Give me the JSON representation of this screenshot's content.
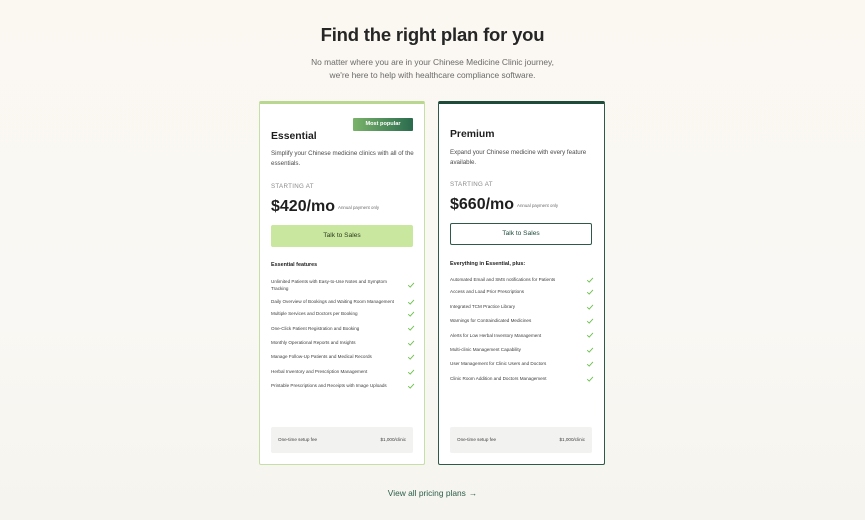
{
  "header": {
    "title": "Find the right plan for you",
    "subtitle_line1": "No matter where you are in your Chinese Medicine Clinic journey,",
    "subtitle_line2": "we're here to help with healthcare compliance software."
  },
  "colors": {
    "accent_light_green": "#c9e79f",
    "accent_dark_green": "#1f4b3a",
    "check_green": "#6cc04a"
  },
  "plans": [
    {
      "badge": "Most popular",
      "name": "Essential",
      "description": "Simplify your Chinese medicine clinics with all of the essentials.",
      "starting_label": "STARTING AT",
      "price": "$420/mo",
      "price_note": "Annual payment only",
      "cta": "Talk to Sales",
      "features_title": "Essential features",
      "features": [
        "Unlimited Patients with Easy-to-Use Notes and Symptom Tracking",
        "Daily Overview of Bookings and Waiting Room Management",
        "Multiple Services and Doctors per Booking",
        "One-Click Patient Registration and Booking",
        "Monthly Operational Reports and Insights",
        "Manage Follow-Up Patients and Medical Records",
        "Herbal Inventory and Prescription Management",
        "Printable Prescriptions and Receipts with Image Uploads"
      ],
      "setup_label": "One-time setup fee",
      "setup_value": "$1,000/clinic"
    },
    {
      "name": "Premium",
      "description": "Expand your Chinese medicine with every feature available.",
      "starting_label": "STARTING AT",
      "price": "$660/mo",
      "price_note": "Annual payment only",
      "cta": "Talk to Sales",
      "features_title": "Everything in Essential, plus:",
      "features": [
        "Automated Email and SMS notifications for Patients",
        "Access and Load Prior Prescriptions",
        "Integrated TCM Practice Library",
        "Warnings for Contraindicated Medicines",
        "Alerts for Low Herbal Inventory Management",
        "Multi-clinic Management Capability",
        "User Management for Clinic Users and Doctors",
        "Clinic Room Addition and Doctors Management"
      ],
      "setup_label": "One-time setup fee",
      "setup_value": "$1,000/clinic"
    }
  ],
  "footer": {
    "link": "View all pricing plans",
    "arrow_icon": "arrow-right-icon"
  }
}
